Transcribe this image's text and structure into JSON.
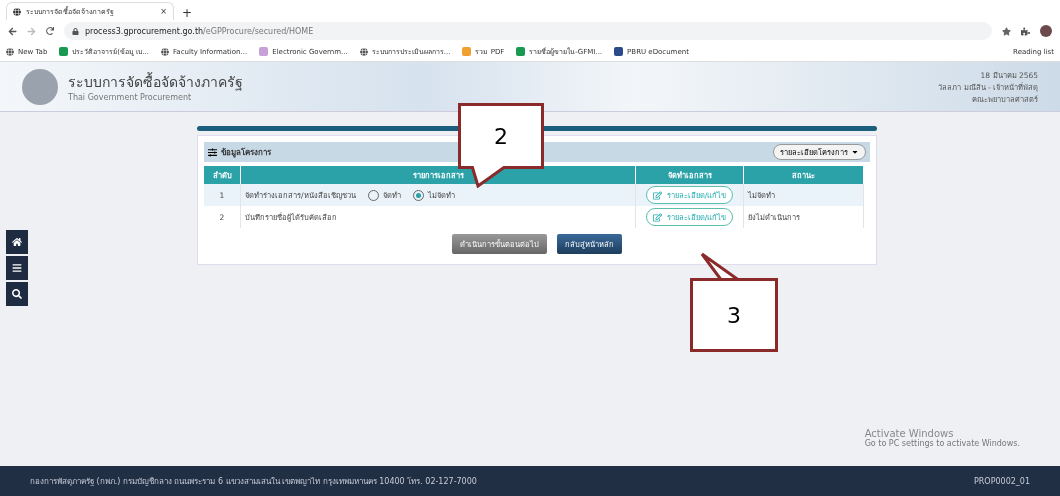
{
  "browser": {
    "tab_title": "ระบบการจัดซื้อจัดจ้างภาครัฐ",
    "tab_close": "×",
    "new_tab": "+",
    "url_host": "process3.gprocurement.go.th",
    "url_path": "/eGPProcure/secured/HOME",
    "bookmarks": [
      {
        "label": "New Tab",
        "kind": "globe"
      },
      {
        "label": "ประวัติอาจารย์(ข้อมู เบ...",
        "kind": "sheet"
      },
      {
        "label": "Faculty Information...",
        "kind": "globe"
      },
      {
        "label": "Electronic Governm...",
        "kind": "flower"
      },
      {
        "label": "ระบบการประเมินผลการ...",
        "kind": "globe"
      },
      {
        "label": "รวม PDF",
        "kind": "dots"
      },
      {
        "label": "รายชื่อผู้ขายใน-GFMI...",
        "kind": "sheet"
      },
      {
        "label": "PBRU eDocument",
        "kind": "doc"
      }
    ],
    "reading_list": "Reading list"
  },
  "header": {
    "title": "ระบบการจัดซื้อจัดจ้างภาครัฐ",
    "subtitle": "Thai Government Procurement",
    "date": "18 มีนาคม 2565",
    "user": "วัลลภา มณีสิน - เจ้าหน้าที่พัสดุ",
    "department": "คณะพยาบาลศาสตร์"
  },
  "panel": {
    "title": "ข้อมูลโครงการ",
    "dropdown": "รายละเอียดโครงการ",
    "columns": [
      "ลำดับ",
      "รายการเอกสาร",
      "จัดทำเอกสาร",
      "สถานะ"
    ],
    "rows": [
      {
        "no": "1",
        "document": "จัดทำร่างเอกสาร/หนังสือเชิญชวน",
        "options": [
          {
            "label": "จัดทำ",
            "selected": false
          },
          {
            "label": "ไม่จัดทำ",
            "selected": true
          }
        ],
        "action": "รายละเอียด/แก้ไข",
        "status": "ไม่จัดทำ"
      },
      {
        "no": "2",
        "document": "บันทึกรายชื่อผู้ได้รับคัดเลือก",
        "options": [],
        "action": "รายละเอียด/แก้ไข",
        "status": "ยังไม่ดำเนินการ"
      }
    ],
    "buttons": [
      {
        "label": "ดำเนินการขั้นตอนต่อไป",
        "disabled": true
      },
      {
        "label": "กลับสู่หน้าหลัก",
        "disabled": false
      }
    ]
  },
  "callouts": [
    "2",
    "3"
  ],
  "windows_notice": {
    "title": "Activate Windows",
    "text": "Go to PC settings to activate Windows."
  },
  "footer": {
    "address": "กองการพัสดุภาครัฐ (กพภ.) กรมบัญชีกลาง ถนนพระราม 6 แขวงสามเสนใน เขตพญาไท กรุงเทพมหานคร 10400 โทร. 02-127-7000",
    "code": "PROP0002_01"
  }
}
